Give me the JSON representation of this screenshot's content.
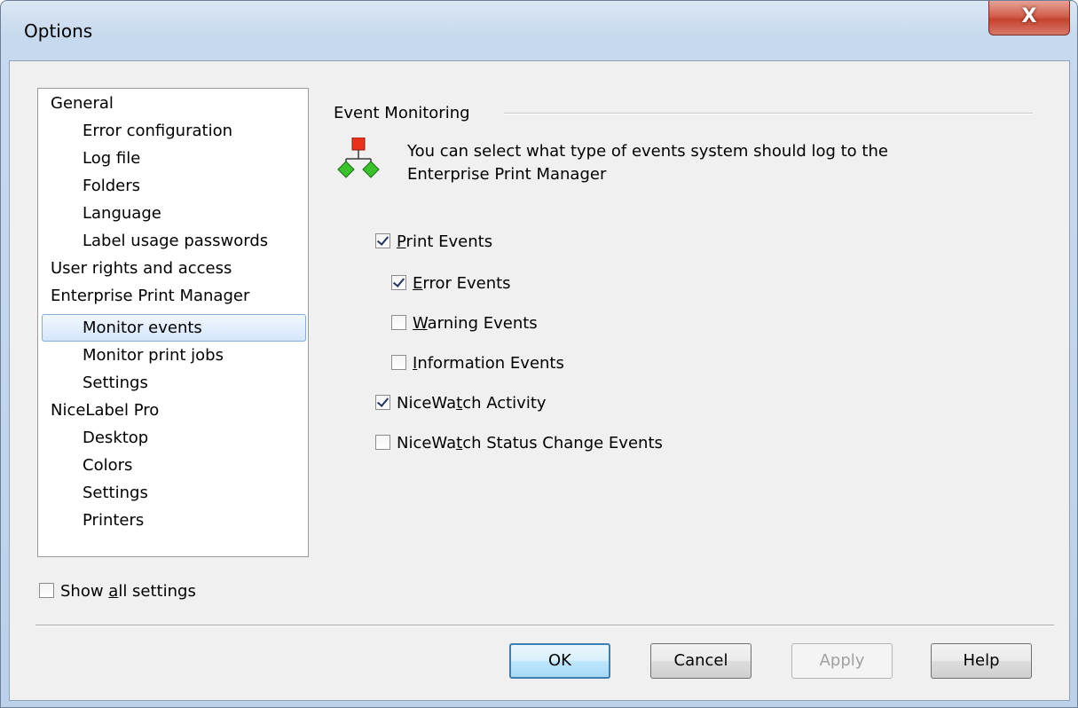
{
  "window": {
    "title": "Options",
    "close_glyph": "X"
  },
  "tree": {
    "items": [
      {
        "label": "General",
        "level": 0
      },
      {
        "label": "Error configuration",
        "level": 1
      },
      {
        "label": "Log file",
        "level": 1
      },
      {
        "label": "Folders",
        "level": 1
      },
      {
        "label": "Language",
        "level": 1
      },
      {
        "label": "Label usage passwords",
        "level": 1
      },
      {
        "label": "User rights and access",
        "level": 0
      },
      {
        "label": "Enterprise Print Manager",
        "level": 0
      },
      {
        "label": "Monitor events",
        "level": 1,
        "selected": true
      },
      {
        "label": "Monitor print jobs",
        "level": 1
      },
      {
        "label": "Settings",
        "level": 1
      },
      {
        "label": "NiceLabel Pro",
        "level": 0
      },
      {
        "label": "Desktop",
        "level": 1
      },
      {
        "label": "Colors",
        "level": 1
      },
      {
        "label": "Settings",
        "level": 1
      },
      {
        "label": "Printers",
        "level": 1
      }
    ]
  },
  "show_all": {
    "pre": "Show ",
    "mn": "a",
    "post": "ll settings",
    "checked": false
  },
  "panel": {
    "group_title": "Event Monitoring",
    "icon": "hierarchy-icon",
    "description_line1": "You can select what type of events system should log to the",
    "description_line2": "Enterprise Print Manager",
    "checkboxes": [
      {
        "pre": "",
        "mn": "P",
        "post": "rint Events",
        "checked": true
      },
      {
        "pre": "",
        "mn": "E",
        "post": "rror Events",
        "checked": true
      },
      {
        "pre": "",
        "mn": "W",
        "post": "arning Events",
        "checked": false
      },
      {
        "pre": "",
        "mn": "I",
        "post": "nformation Events",
        "checked": false
      },
      {
        "pre": "NiceWa",
        "mn": "t",
        "post": "ch Activity",
        "checked": true
      },
      {
        "pre": "NiceWa",
        "mn": "t",
        "post": "ch Status Change Events",
        "checked": false
      }
    ]
  },
  "buttons": {
    "ok": "OK",
    "cancel": "Cancel",
    "apply": "Apply",
    "help": "Help"
  },
  "colors": {
    "selection_border": "#84acdd",
    "default_button_border": "#3c7fb1",
    "check_mark": "#21325e",
    "close_red": "#c5432f"
  }
}
